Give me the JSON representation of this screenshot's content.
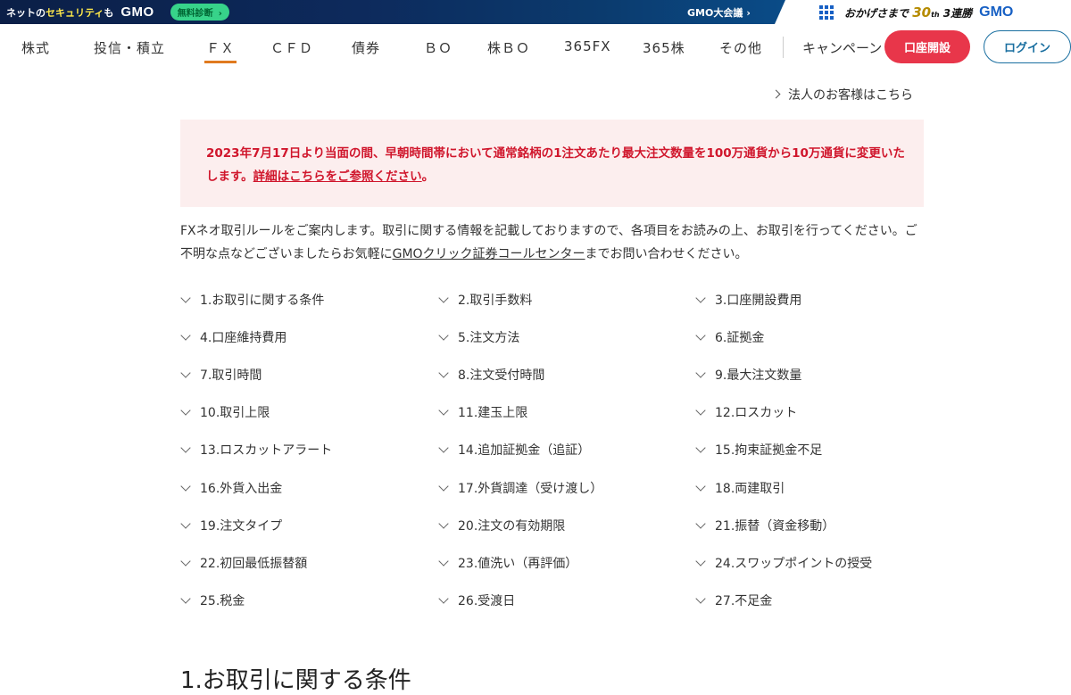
{
  "topbar": {
    "security_prefix": "ネットの",
    "security_highlight": "セキュリティ",
    "security_suffix": "も",
    "gmo_logo": "GMO",
    "diagnosis_label": "無料診断",
    "diagnosis_arrow": "›",
    "taikai_label": "GMO大会議",
    "taikai_arrow": "›",
    "anniv_prefix": "おかげさまで",
    "anniv_number": "30",
    "anniv_unit": "th",
    "anniv_suffix": "3連勝",
    "gmo_logo2": "GMO"
  },
  "nav": {
    "items": [
      "株式",
      "投信・積立",
      "ＦＸ",
      "ＣＦＤ",
      "債券",
      "ＢＯ",
      "株ＢＯ",
      "365FX",
      "365株",
      "その他",
      "キャンペーン"
    ],
    "active": "ＦＸ",
    "open_account": "口座開設",
    "login": "ログイン"
  },
  "corporate_link": "法人のお客様はこちら",
  "notice": {
    "text": "2023年7月17日より当面の間、早朝時間帯において通常銘柄の1注文あたり最大注文数量を100万通貨から10万通貨に変更いたします。",
    "link": "詳細はこちらをご参照ください",
    "tail": "。"
  },
  "intro": {
    "before": "FXネオ取引ルールをご案内します。取引に関する情報を記載しておりますので、各項目をお読みの上、お取引を行ってください。ご不明な点などございましたらお気軽に",
    "link": "GMOクリック証券コールセンター",
    "after": "までお問い合わせください。"
  },
  "toc": [
    "1.お取引に関する条件",
    "2.取引手数料",
    "3.口座開設費用",
    "4.口座維持費用",
    "5.注文方法",
    "6.証拠金",
    "7.取引時間",
    "8.注文受付時間",
    "9.最大注文数量",
    "10.取引上限",
    "11.建玉上限",
    "12.ロスカット",
    "13.ロスカットアラート",
    "14.追加証拠金（追証）",
    "15.拘束証拠金不足",
    "16.外貨入出金",
    "17.外貨調達（受け渡し）",
    "18.両建取引",
    "19.注文タイプ",
    "20.注文の有効期限",
    "21.振替（資金移動）",
    "22.初回最低振替額",
    "23.値洗い（再評価）",
    "24.スワップポイントの授受",
    "25.税金",
    "26.受渡日",
    "27.不足金"
  ],
  "section_title": "1.お取引に関する条件"
}
